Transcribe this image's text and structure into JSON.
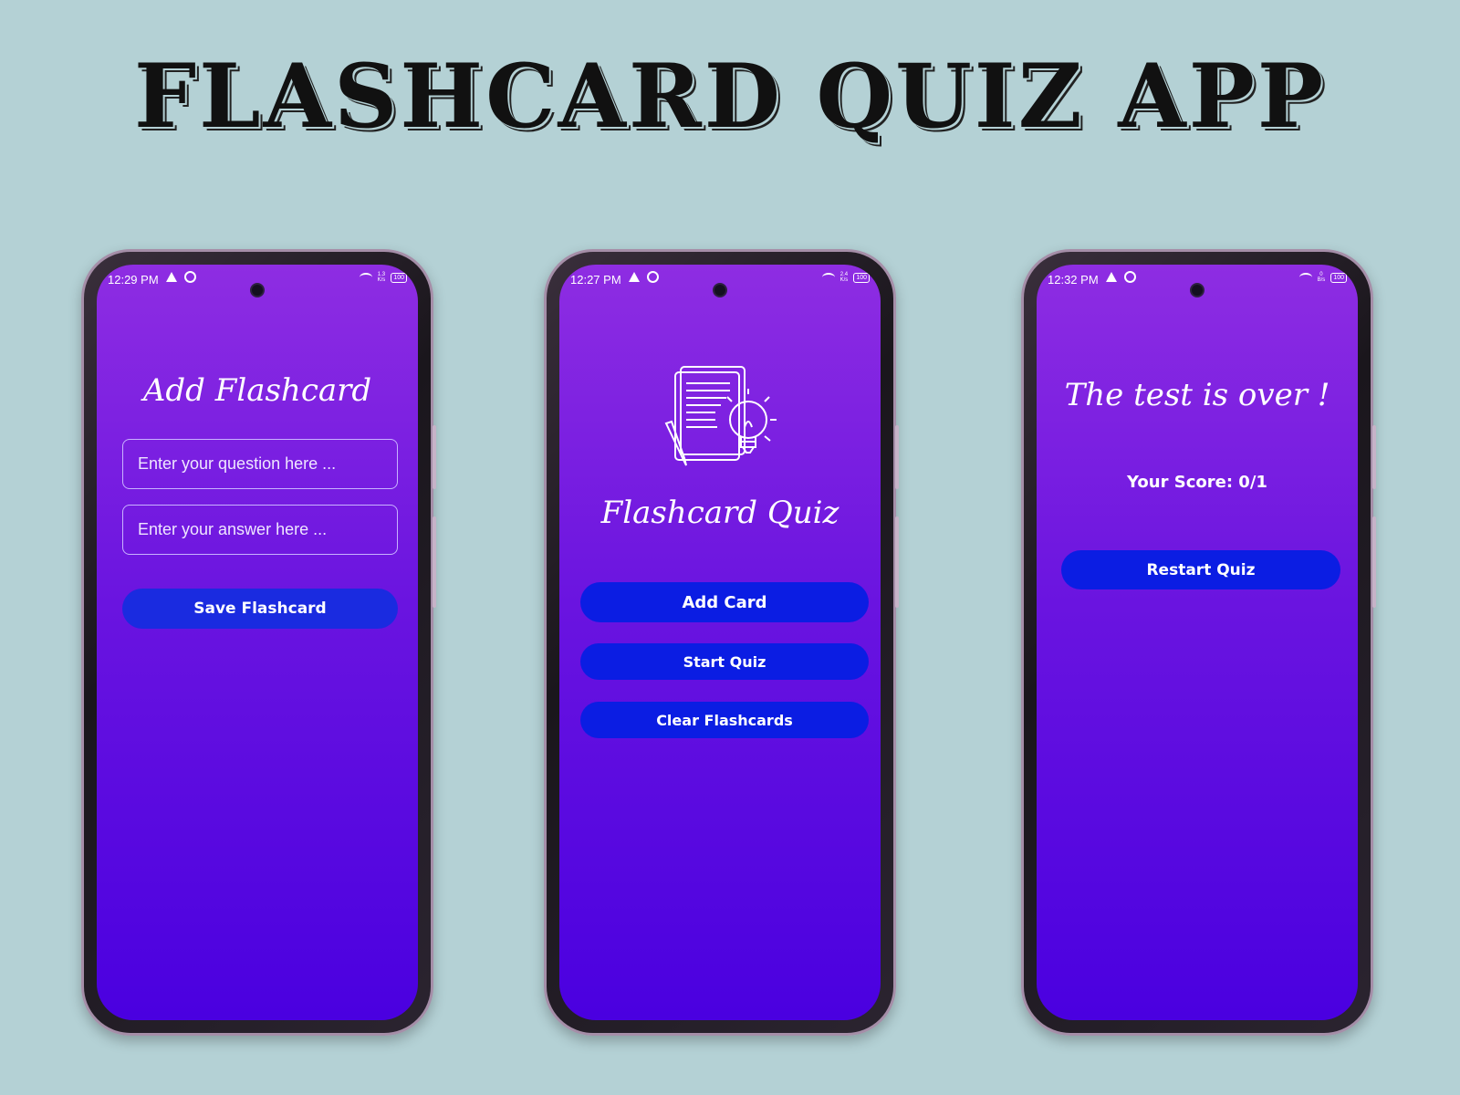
{
  "page": {
    "title": "FLASHCARD QUIZ APP"
  },
  "screens": [
    {
      "status": {
        "time": "12:29 PM",
        "speed_top": "1.3",
        "speed_bottom": "K/s",
        "battery": "100"
      },
      "title": "Add Flashcard",
      "question": {
        "placeholder": "Enter your question here ..."
      },
      "answer": {
        "placeholder": "Enter your answer here ..."
      },
      "save_button": "Save Flashcard"
    },
    {
      "status": {
        "time": "12:27 PM",
        "speed_top": "2.4",
        "speed_bottom": "K/s",
        "battery": "100"
      },
      "title": "Flashcard Quiz",
      "illustration": "notes-and-lightbulb-icon",
      "buttons": {
        "add_card": "Add Card",
        "start_quiz": "Start Quiz",
        "clear": "Clear Flashcards"
      }
    },
    {
      "status": {
        "time": "12:32 PM",
        "speed_top": "0",
        "speed_bottom": "B/s",
        "battery": "100"
      },
      "title": "The test is over !",
      "score": "Your Score: 0/1",
      "restart_button": "Restart Quiz"
    }
  ],
  "colors": {
    "background": "#b4d1d5",
    "screen_gradient_top": "#8e2de2",
    "screen_gradient_bottom": "#4a00e0",
    "button_blue": "#0b1de3"
  }
}
